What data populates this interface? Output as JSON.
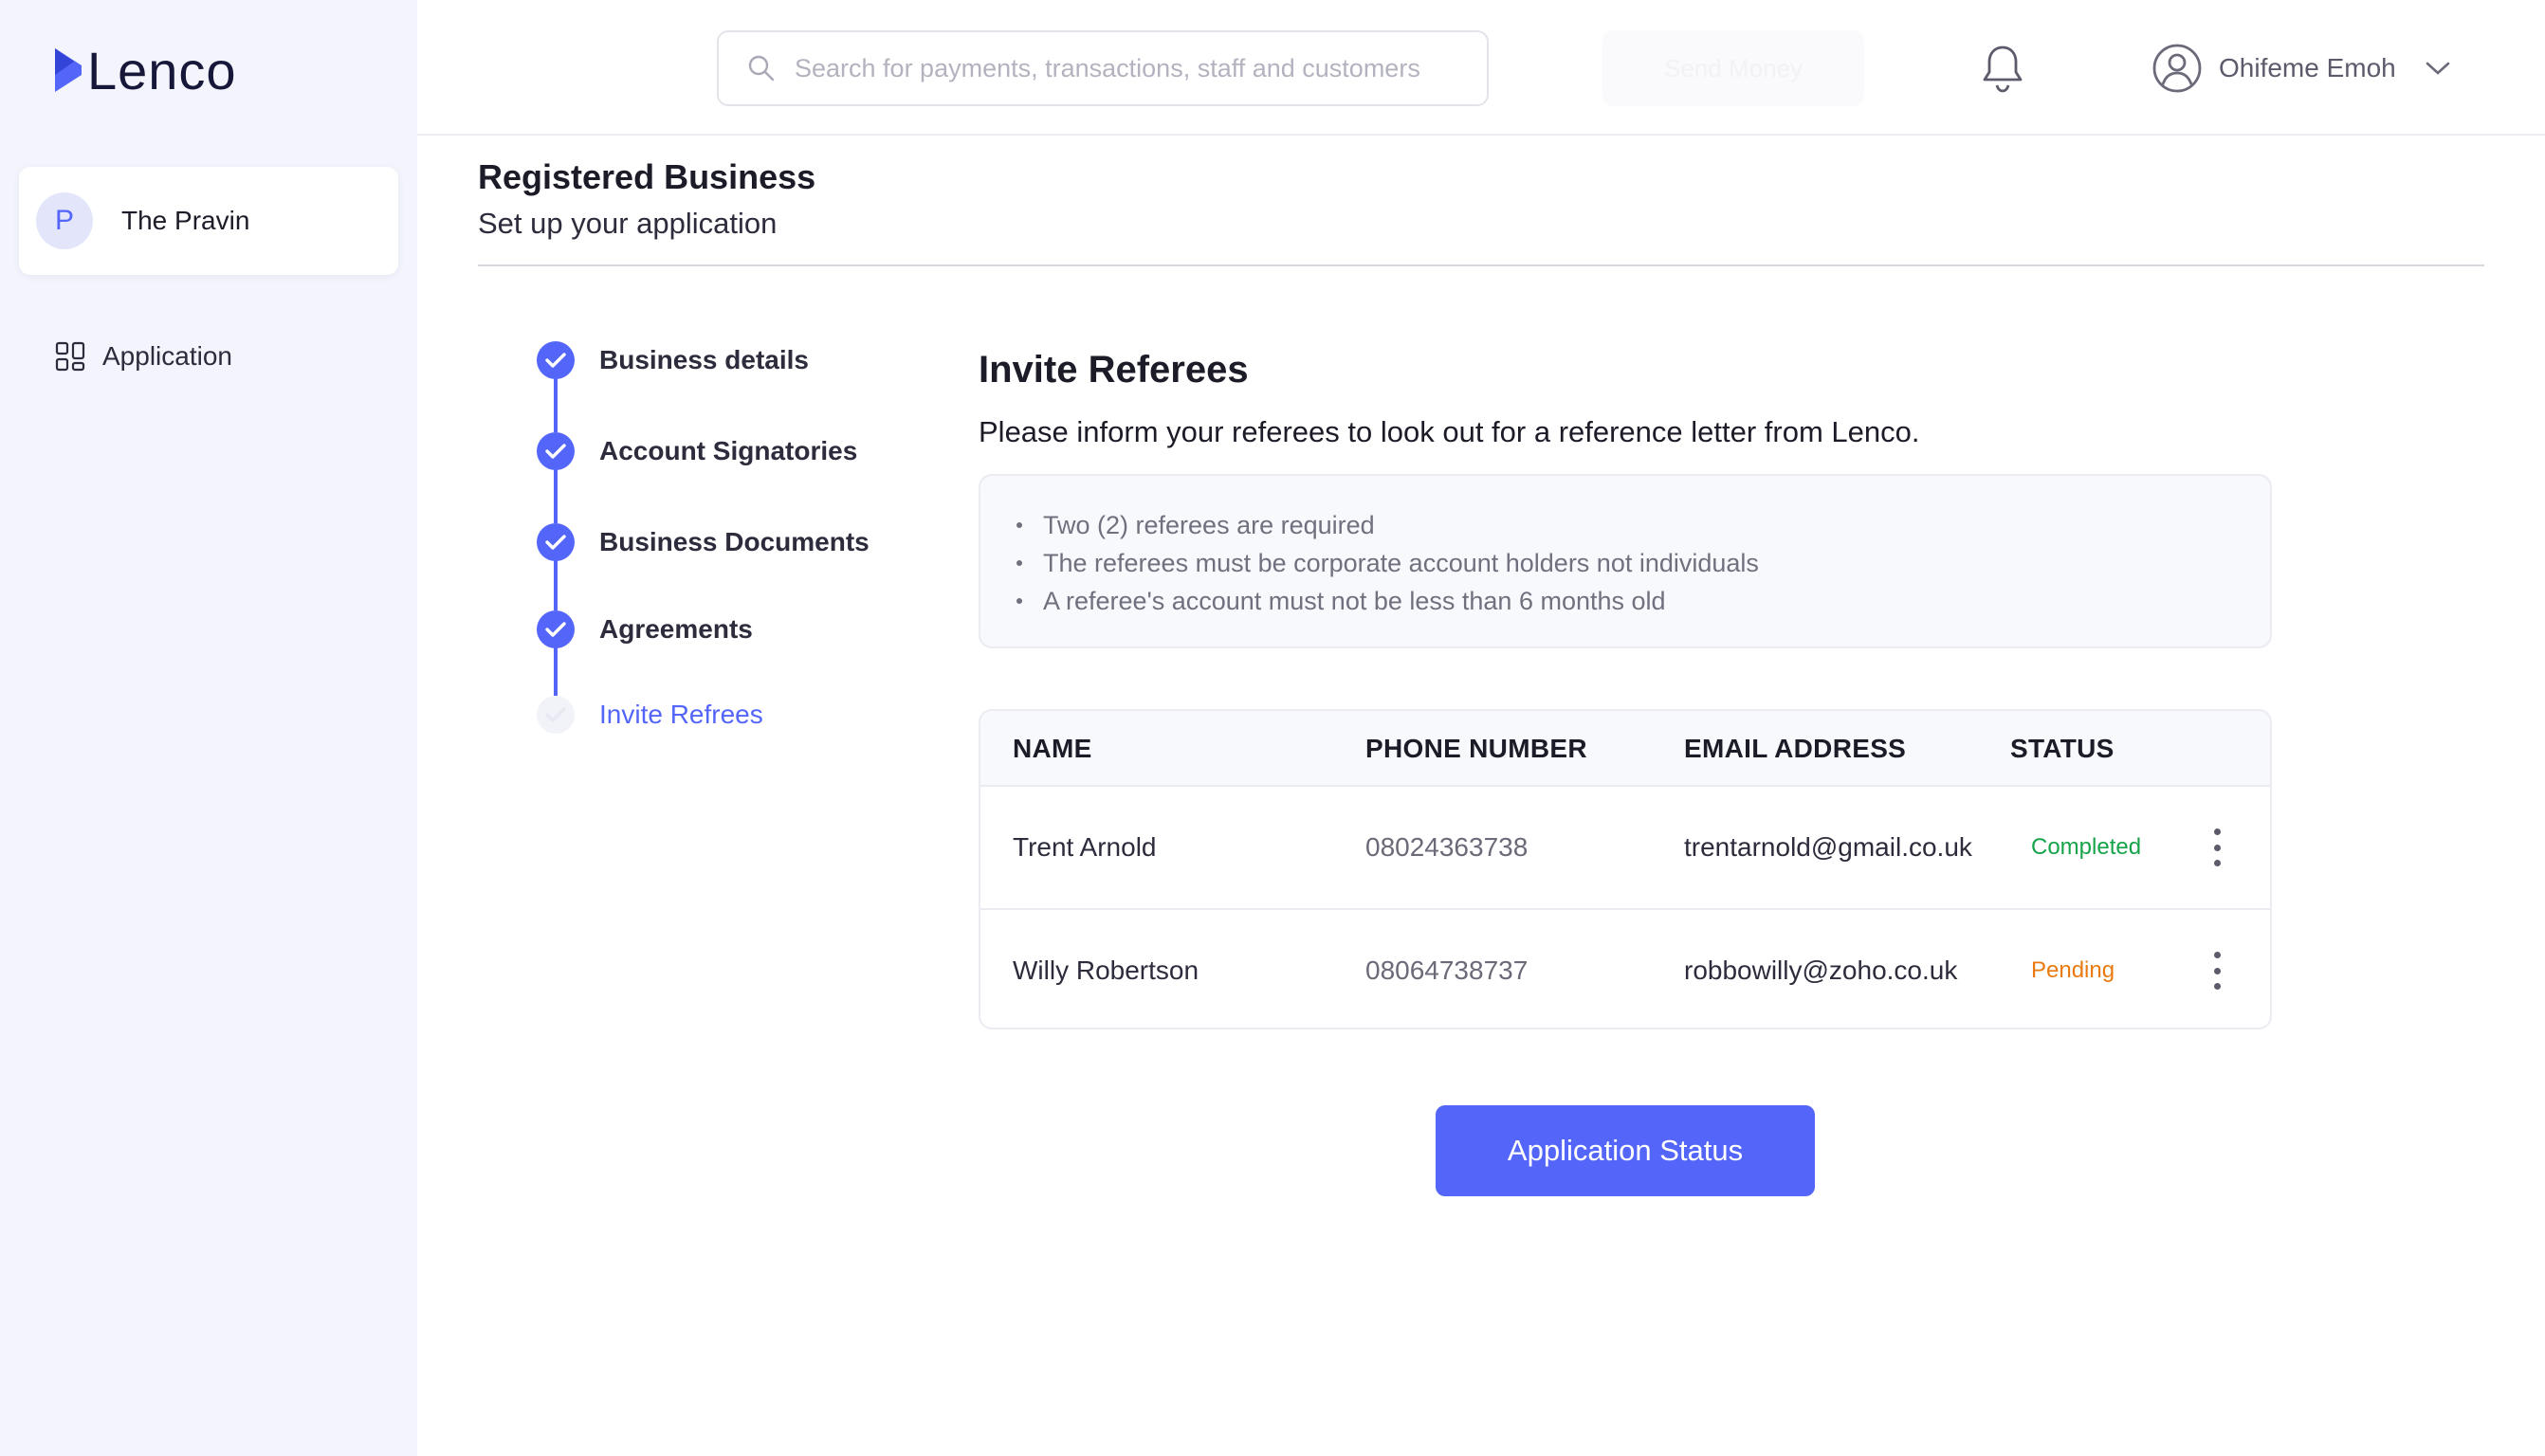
{
  "app": {
    "brand": "Lenco",
    "brand_color": "#5466f9"
  },
  "sidebar": {
    "account": {
      "initial": "P",
      "name": "The Pravin"
    },
    "items": [
      {
        "label": "Application",
        "icon": "grid-icon"
      }
    ]
  },
  "header": {
    "search": {
      "placeholder": "Search for payments, transactions, staff and customers",
      "icon": "search-icon"
    },
    "faint_button_label": "Send Money",
    "notification_icon": "bell-icon",
    "user": {
      "name": "Ohifeme Emoh",
      "icon": "user-circle-icon",
      "dropdown_icon": "chevron-down-icon"
    }
  },
  "page": {
    "title": "Registered Business",
    "subtitle": "Set up your application"
  },
  "stepper": {
    "steps": [
      {
        "label": "Business details",
        "state": "completed"
      },
      {
        "label": "Account Signatories",
        "state": "completed"
      },
      {
        "label": "Business Documents",
        "state": "completed"
      },
      {
        "label": "Agreements",
        "state": "completed"
      },
      {
        "label": "Invite Refrees",
        "state": "active"
      }
    ]
  },
  "section": {
    "title": "Invite Referees",
    "subtitle": "Please inform your referees to look out for a reference letter from Lenco.",
    "requirements": [
      "Two (2) referees are required",
      "The referees must be corporate account holders not individuals",
      "A referee's account must not be less than 6 months old"
    ]
  },
  "table": {
    "columns": [
      "NAME",
      "PHONE NUMBER",
      "EMAIL ADDRESS",
      "STATUS"
    ],
    "rows": [
      {
        "name": "Trent Arnold",
        "phone": "08024363738",
        "email": "trentarnold@gmail.co.uk",
        "status": "Completed",
        "status_color": "#16a34a"
      },
      {
        "name": "Willy Robertson",
        "phone": "08064738737",
        "email": "robbowilly@zoho.co.uk",
        "status": "Pending",
        "status_color": "#ea7a10"
      }
    ]
  },
  "actions": {
    "primary_label": "Application Status"
  }
}
